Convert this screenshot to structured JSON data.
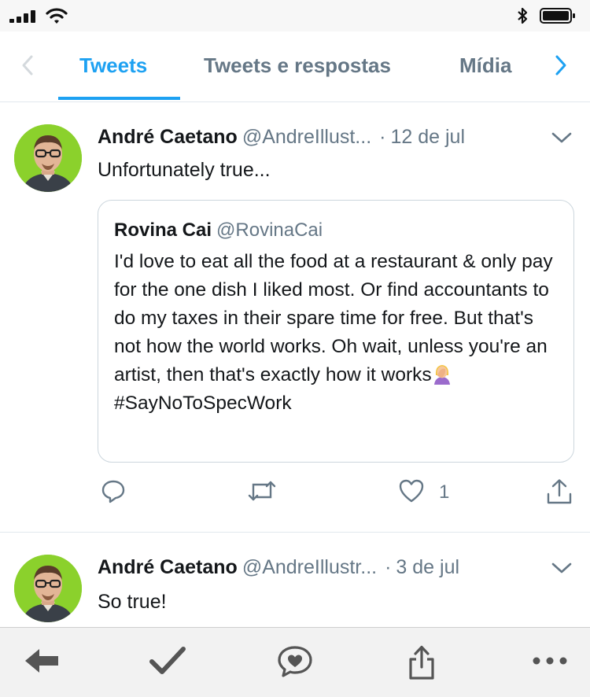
{
  "status_bar": {
    "icons": [
      "signal-icon",
      "wifi-icon",
      "bluetooth-icon",
      "battery-icon"
    ]
  },
  "tabs": [
    {
      "label": "Tweets",
      "active": true
    },
    {
      "label": "Tweets e respostas",
      "active": false
    },
    {
      "label": "Mídia",
      "active": false
    }
  ],
  "tweets": [
    {
      "author": "André Caetano",
      "handle": "@AndreIllust...",
      "separator": "·",
      "date": "12 de jul",
      "text": "Unfortunately true...",
      "quote": {
        "author": "Rovina Cai",
        "handle": "@RovinaCai",
        "text": "I'd love to eat all the food at a restaurant & only pay for the one dish I liked most. Or find accountants to do my taxes in their spare time for free. But that's not how the world works. Oh wait, unless you're an artist, then that's exactly how it works",
        "hashtag": "#SayNoToSpecWork"
      },
      "like_count": "1"
    },
    {
      "author": "André Caetano",
      "handle": "@AndreIllustr...",
      "separator": "·",
      "date": "3 de jul",
      "text": "So true!"
    }
  ],
  "colors": {
    "accent": "#1da1f2",
    "muted": "#657786",
    "text": "#14171a",
    "border": "#e1e8ed",
    "avatar_bg": "#8bd12c"
  },
  "bottom_bar": {
    "icons": [
      "back-arrow-icon",
      "checkmark-icon",
      "chat-heart-icon",
      "share-icon",
      "more-icon"
    ]
  }
}
